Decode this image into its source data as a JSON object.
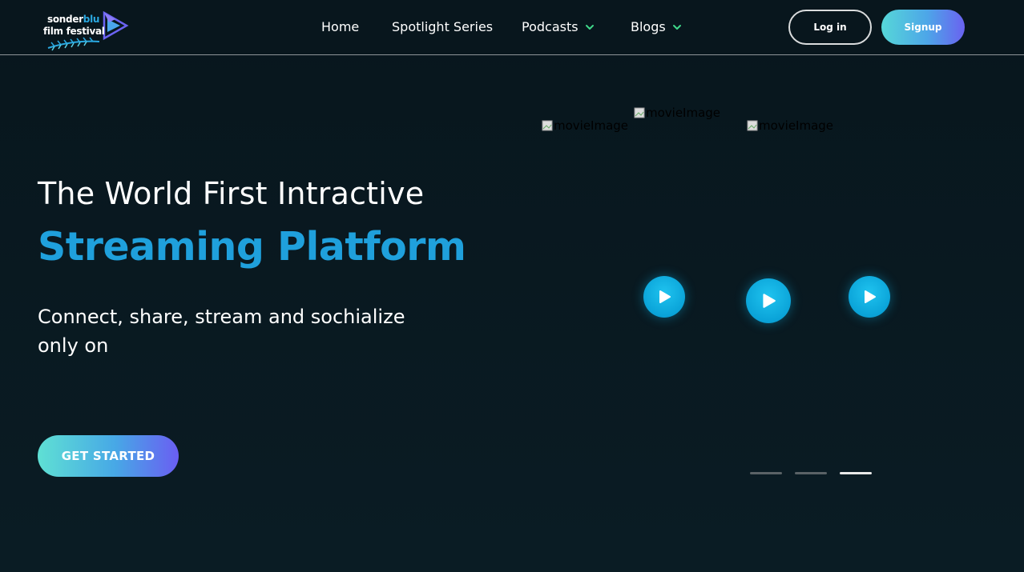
{
  "header": {
    "logo": {
      "line1_a": "sonder",
      "line1_b": "blu",
      "line2": "film festival"
    },
    "nav": [
      {
        "label": "Home",
        "has_dropdown": false
      },
      {
        "label": "Spotlight Series",
        "has_dropdown": false
      },
      {
        "label": "Podcasts",
        "has_dropdown": true
      },
      {
        "label": "Blogs",
        "has_dropdown": true
      }
    ],
    "login_label": "Log in",
    "signup_label": "Signup"
  },
  "hero": {
    "title_line1": "The World First Intractive",
    "title_line2": "Streaming Platform",
    "subtitle": "Connect, share, stream and sochialize only on",
    "cta_label": "GET STARTED"
  },
  "carousel": {
    "images": [
      {
        "alt": "movieImage"
      },
      {
        "alt": "movieImage"
      },
      {
        "alt": "movieImage"
      }
    ],
    "play_icons": [
      "play-icon",
      "play-icon",
      "play-icon"
    ],
    "indicators": [
      {
        "active": false
      },
      {
        "active": false
      },
      {
        "active": true
      }
    ]
  },
  "colors": {
    "background": "#08161d",
    "accent_blue": "#1fa0dc",
    "chevron_green": "#3fd88a",
    "play_blue": "#0aa3d8"
  }
}
